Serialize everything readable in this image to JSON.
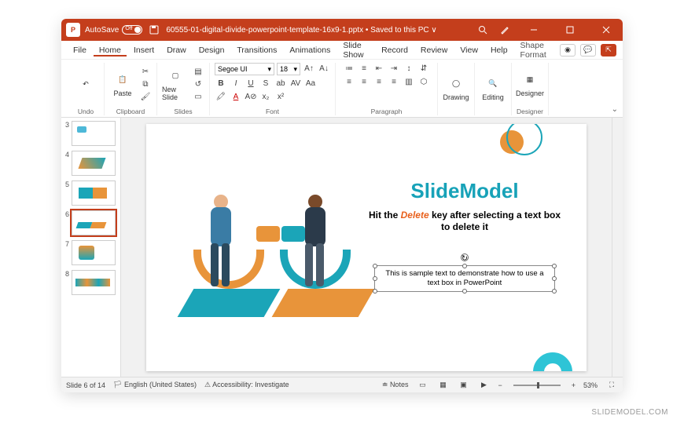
{
  "titlebar": {
    "autosave_label": "AutoSave",
    "autosave_state": "Off",
    "filename": "60555-01-digital-divide-powerpoint-template-16x9-1.pptx",
    "save_status": "Saved to this PC"
  },
  "menu": {
    "tabs": [
      "File",
      "Home",
      "Insert",
      "Draw",
      "Design",
      "Transitions",
      "Animations",
      "Slide Show",
      "Record",
      "Review",
      "View",
      "Help",
      "Shape Format"
    ],
    "active": "Home"
  },
  "ribbon": {
    "undo": "Undo",
    "clipboard": "Clipboard",
    "paste": "Paste",
    "slides": "Slides",
    "new_slide": "New Slide",
    "font": "Font",
    "font_name": "Segoe UI",
    "font_size": "18",
    "paragraph": "Paragraph",
    "drawing": "Drawing",
    "editing": "Editing",
    "designer": "Designer"
  },
  "thumbs": {
    "visible_numbers": [
      3,
      4,
      5,
      6,
      7,
      8
    ],
    "active": 6
  },
  "slide": {
    "brand": "SlideModel",
    "instr_pre": "Hit the ",
    "instr_em": "Delete",
    "instr_post": " key after selecting a text box to delete it",
    "sample_text": "This is sample text to demonstrate how to use a text box in PowerPoint"
  },
  "status": {
    "slide_info": "Slide 6 of 14",
    "language": "English (United States)",
    "accessibility": "Accessibility: Investigate",
    "notes": "Notes",
    "zoom": "53%"
  },
  "watermark": "SLIDEMODEL.COM"
}
